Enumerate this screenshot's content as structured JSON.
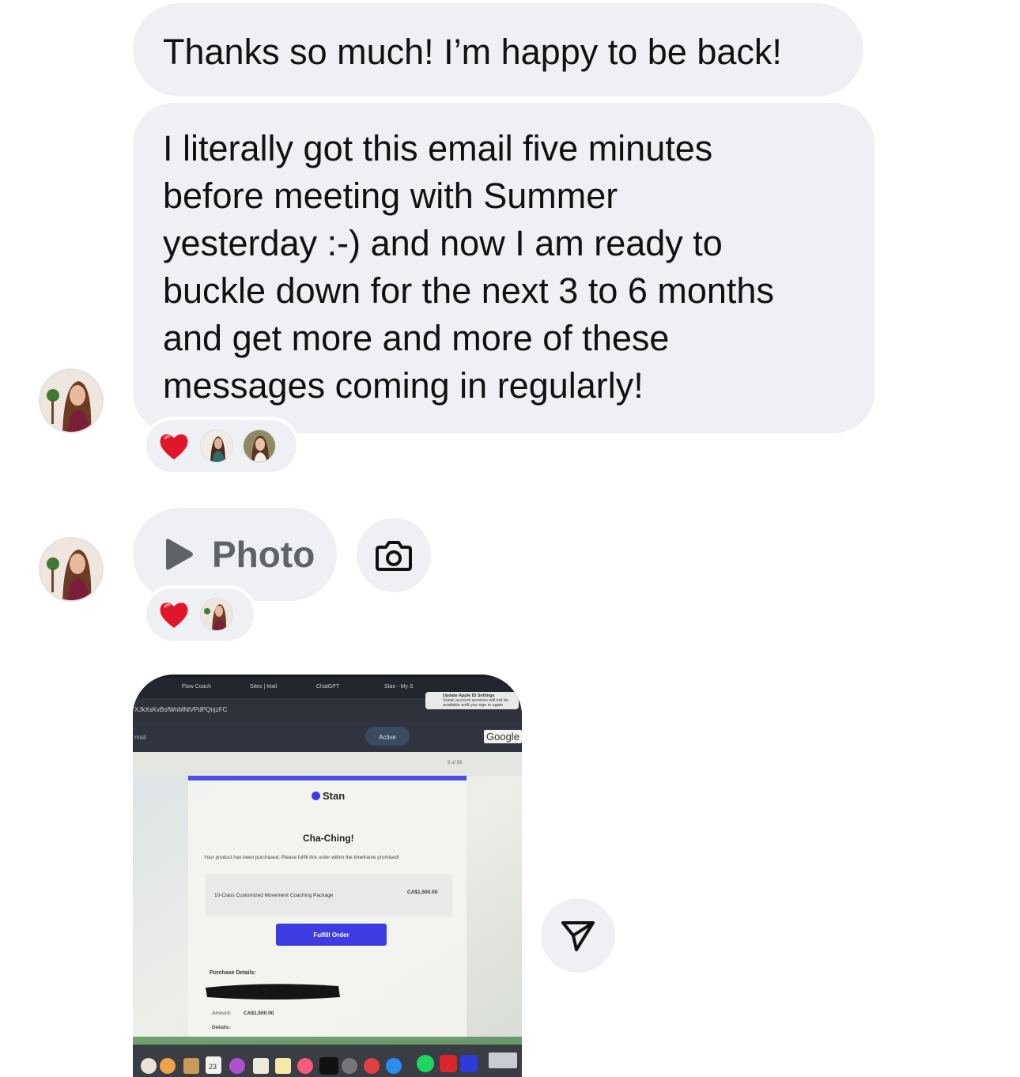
{
  "messages": [
    {
      "text": "Thanks so much! I’m happy to be back!"
    },
    {
      "text": "I literally got this email five minutes\nbefore meeting with Summer\nyesterday :-) and now I am ready to\nbuckle down for the next 3 to 6 months\nand get more and more of these\nmessages coming in regularly!"
    }
  ],
  "photo_message": {
    "label": "Photo",
    "icon": "play-icon"
  },
  "icons": {
    "camera": "camera-icon",
    "share": "send-icon",
    "reaction": "heart-icon"
  },
  "colors": {
    "bubble": "#eff0f3",
    "heart": "#e0162b",
    "stan_button": "#3d3ce0"
  },
  "screenshot": {
    "tabs": [
      "Flow Coach",
      "Sites | Mail",
      "ChatGPT",
      "Stan - My S"
    ],
    "url_fragment": "XJkXsKvBsfWnMNlVPdPQnjzFC",
    "notification_title": "Update Apple ID Settings",
    "notification_body": "Some account services will not be available until you sign in again",
    "search_label": "mail",
    "status": "Active",
    "google": "Google",
    "pager": "5 of 59",
    "brand": "Stan",
    "heading": "Cha-Ching!",
    "body": "Your product has been purchased. Please fulfill this order within the timeframe promised!",
    "product": "10-Class Customized Movement Coaching Package",
    "price": "CA$1,500.00",
    "button": "Fulfill Order",
    "purchase_details": "Purchase Details:",
    "amount_label": "Amount:",
    "amount": "CA$1,500.00",
    "details_label": "Details:",
    "dock_date": "23"
  }
}
